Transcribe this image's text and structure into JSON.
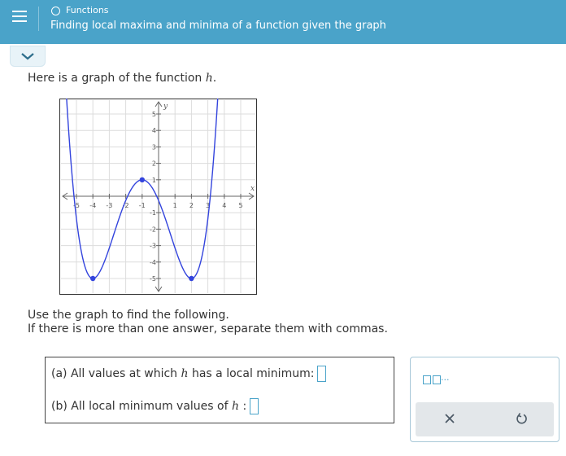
{
  "header": {
    "category": "Functions",
    "topic": "Finding local maxima and minima of a function given the graph"
  },
  "intro": {
    "text": "Here is a graph of the function ",
    "fn": "h",
    "end": "."
  },
  "graph": {
    "x_label": "x",
    "y_label": "y",
    "x_ticks": [
      "-5",
      "-4",
      "-3",
      "-2",
      "-1",
      "1",
      "2",
      "3",
      "4",
      "5"
    ],
    "y_ticks": [
      "5",
      "4",
      "3",
      "2",
      "1",
      "-1",
      "-2",
      "-3",
      "-4",
      "-5"
    ],
    "curve_color": "#3344dd",
    "key_points": [
      {
        "x": -4,
        "y": -5
      },
      {
        "x": -1,
        "y": 1
      },
      {
        "x": 2,
        "y": -5
      }
    ]
  },
  "instructions": {
    "line1": "Use the graph to find the following.",
    "line2": "If there is more than one answer, separate them with commas."
  },
  "questions": {
    "a_prefix": "(a) All values at which ",
    "a_fn": "h",
    "a_suffix": " has a local minimum:",
    "b_prefix": "(b) All local minimum values of ",
    "b_fn": "h",
    "b_suffix": " :"
  },
  "toolbar": {
    "template_ellipsis": "...",
    "clear_icon": "close-icon",
    "undo_icon": "undo-icon"
  },
  "colors": {
    "header_bg": "#4aa3c9",
    "accent": "#4aa3c9"
  }
}
